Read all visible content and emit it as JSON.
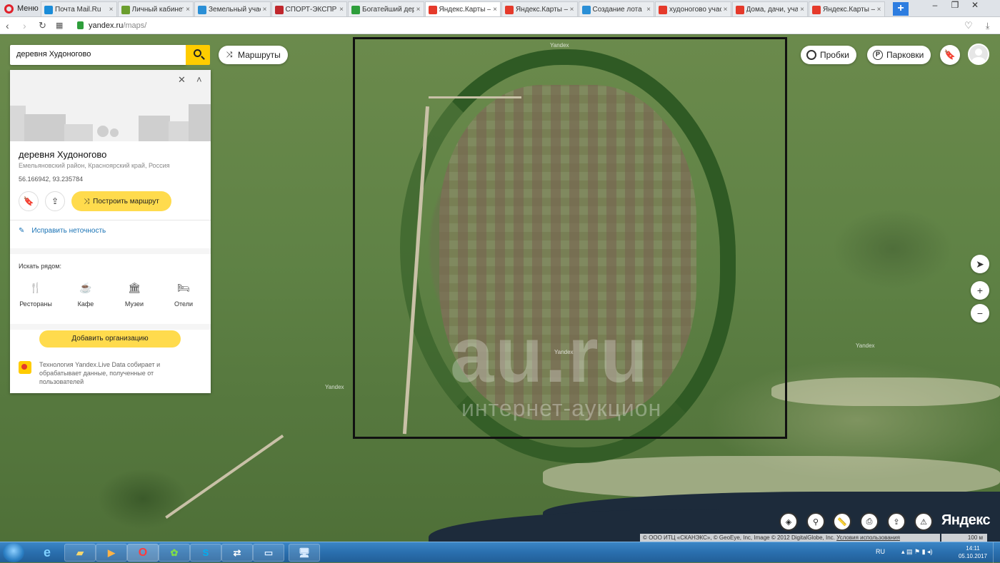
{
  "browser": {
    "menu_label": "Меню",
    "tabs": [
      {
        "title": "Почта Mail.Ru",
        "favicon": "mail-ru-icon",
        "color": "#1a8cd8",
        "active": false
      },
      {
        "title": "Личный кабинет",
        "favicon": "flower-icon",
        "color": "#6b9e2e",
        "active": false
      },
      {
        "title": "Земельный учас",
        "favicon": "au-icon",
        "color": "#2a8fd6",
        "active": false
      },
      {
        "title": "СПОРТ-ЭКСПРЕС",
        "favicon": "sport-icon",
        "color": "#c0272d",
        "active": false
      },
      {
        "title": "Богатейший дер",
        "favicon": "doc-icon",
        "color": "#2e9e3b",
        "active": false
      },
      {
        "title": "Яндекс.Карты —",
        "favicon": "yandex-maps-icon",
        "color": "#e53a2b",
        "active": true
      },
      {
        "title": "Яндекс.Карты —",
        "favicon": "yandex-icon",
        "color": "#e53a2b",
        "active": false
      },
      {
        "title": "Создание лота",
        "favicon": "au-icon",
        "color": "#2a8fd6",
        "active": false
      },
      {
        "title": "худоногово учас",
        "favicon": "yandex-icon",
        "color": "#e53a2b",
        "active": false
      },
      {
        "title": "Дома, дачи, учас",
        "favicon": "avito-icon",
        "color": "#e53a2b",
        "active": false
      },
      {
        "title": "Яндекс.Карты —",
        "favicon": "yandex-maps-icon",
        "color": "#e53a2b",
        "active": false
      }
    ],
    "new_tab_label": "+",
    "address": {
      "host": "yandex.ru",
      "path": "/maps/"
    }
  },
  "search": {
    "value": "деревня Худоногово"
  },
  "top_buttons": {
    "routes": "Маршруты",
    "traffic": "Пробки",
    "parking": "Парковки",
    "parking_glyph": "P"
  },
  "place": {
    "title": "деревня Худоногово",
    "subtitle": "Емельяновский район, Красноярский край, Россия",
    "coordinates": "56.166942, 93.235784",
    "route_button": "Построить маршрут",
    "fix_link": "Исправить неточность",
    "nearby_label": "Искать рядом:",
    "categories": [
      {
        "label": "Рестораны",
        "icon": "fork-knife-icon",
        "glyph": "🍴"
      },
      {
        "label": "Кафе",
        "icon": "coffee-cup-icon",
        "glyph": "☕"
      },
      {
        "label": "Музеи",
        "icon": "museum-icon",
        "glyph": "🏛"
      },
      {
        "label": "Отели",
        "icon": "bed-icon",
        "glyph": "🛏"
      }
    ],
    "add_org": "Добавить организацию",
    "live_data_text": "Технология Yandex.Live Data собирает и обрабатывает данные, полученные от пользователей"
  },
  "map": {
    "watermark_main": "au.ru",
    "watermark_sub": "интернет-аукцион",
    "yandex_tile_label": "Yandex",
    "logo": "Яндекс",
    "copyright": "© ООО ИТЦ «СКАНЭКС», © GeoEye, Inc, Image © 2012 DigitalGlobe, Inc.",
    "terms": "Условия использования",
    "scale": "100 м",
    "zoom_in": "+",
    "zoom_out": "−"
  },
  "taskbar": {
    "lang": "RU",
    "time": "14:11",
    "date": "05.10.2017"
  },
  "colors": {
    "yandex_yellow": "#ffcc00",
    "button_yellow": "#ffdb4d",
    "link_blue": "#1a73b5",
    "selection_frame": "#111111"
  }
}
